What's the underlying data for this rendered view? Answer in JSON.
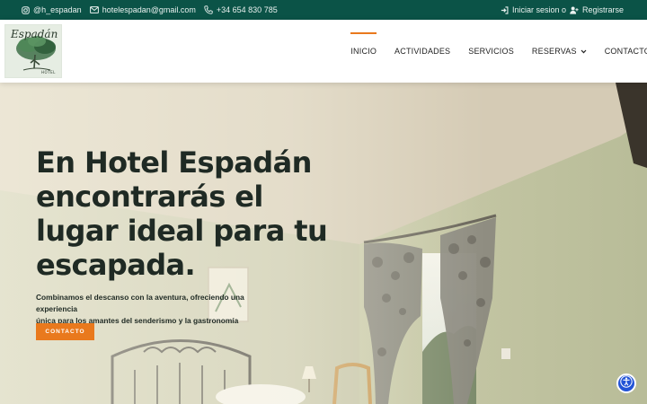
{
  "topbar": {
    "instagram_handle": "@h_espadan",
    "email": "hotelespadan@gmail.com",
    "phone": "+34 654 830 785",
    "login_label": "Iniciar sesion o",
    "register_label": "Registrarse",
    "background_color": "#0b5347"
  },
  "logo": {
    "brand_text": "Espadán",
    "sub_text": "HOTEL"
  },
  "nav": {
    "items": [
      {
        "label": "INICIO",
        "active": true
      },
      {
        "label": "ACTIVIDADES",
        "active": false
      },
      {
        "label": "SERVICIOS",
        "active": false
      },
      {
        "label": "RESERVAS",
        "active": false,
        "has_dropdown": true
      },
      {
        "label": "CONTACTO",
        "active": false
      }
    ],
    "accent_color": "#e9791d"
  },
  "hero": {
    "title": "En Hotel Espadán encontrarás el lugar ideal para tu escapada.",
    "text_line1": "Combinamos el descanso con la aventura, ofreciendo una experiencia",
    "text_line2": "única para los amantes del senderismo y la gastronomía tradicional.",
    "cta_label": "CONTACTO"
  },
  "icons": {
    "instagram": "instagram-icon",
    "email": "envelope-icon",
    "phone": "phone-icon",
    "login": "sign-in-icon",
    "register": "user-plus-icon",
    "dropdown": "chevron-down-icon",
    "accessibility": "accessibility-icon"
  }
}
